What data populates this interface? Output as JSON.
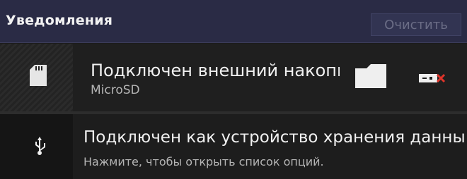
{
  "header": {
    "title": "Уведомления",
    "clear_label": "Очистить"
  },
  "notifications": [
    {
      "icon": "sd-card-icon",
      "title": "Подключен внешний накопит",
      "subtitle": "MicroSD",
      "actions": [
        "folder-icon",
        "eject-icon"
      ]
    },
    {
      "icon": "usb-icon",
      "title": "Подключен как устройство хранения данны",
      "subtitle": "Нажмите, чтобы открыть список опций."
    }
  ],
  "colors": {
    "header_bg": "#2a2b45",
    "eject_x": "#e0342a"
  }
}
